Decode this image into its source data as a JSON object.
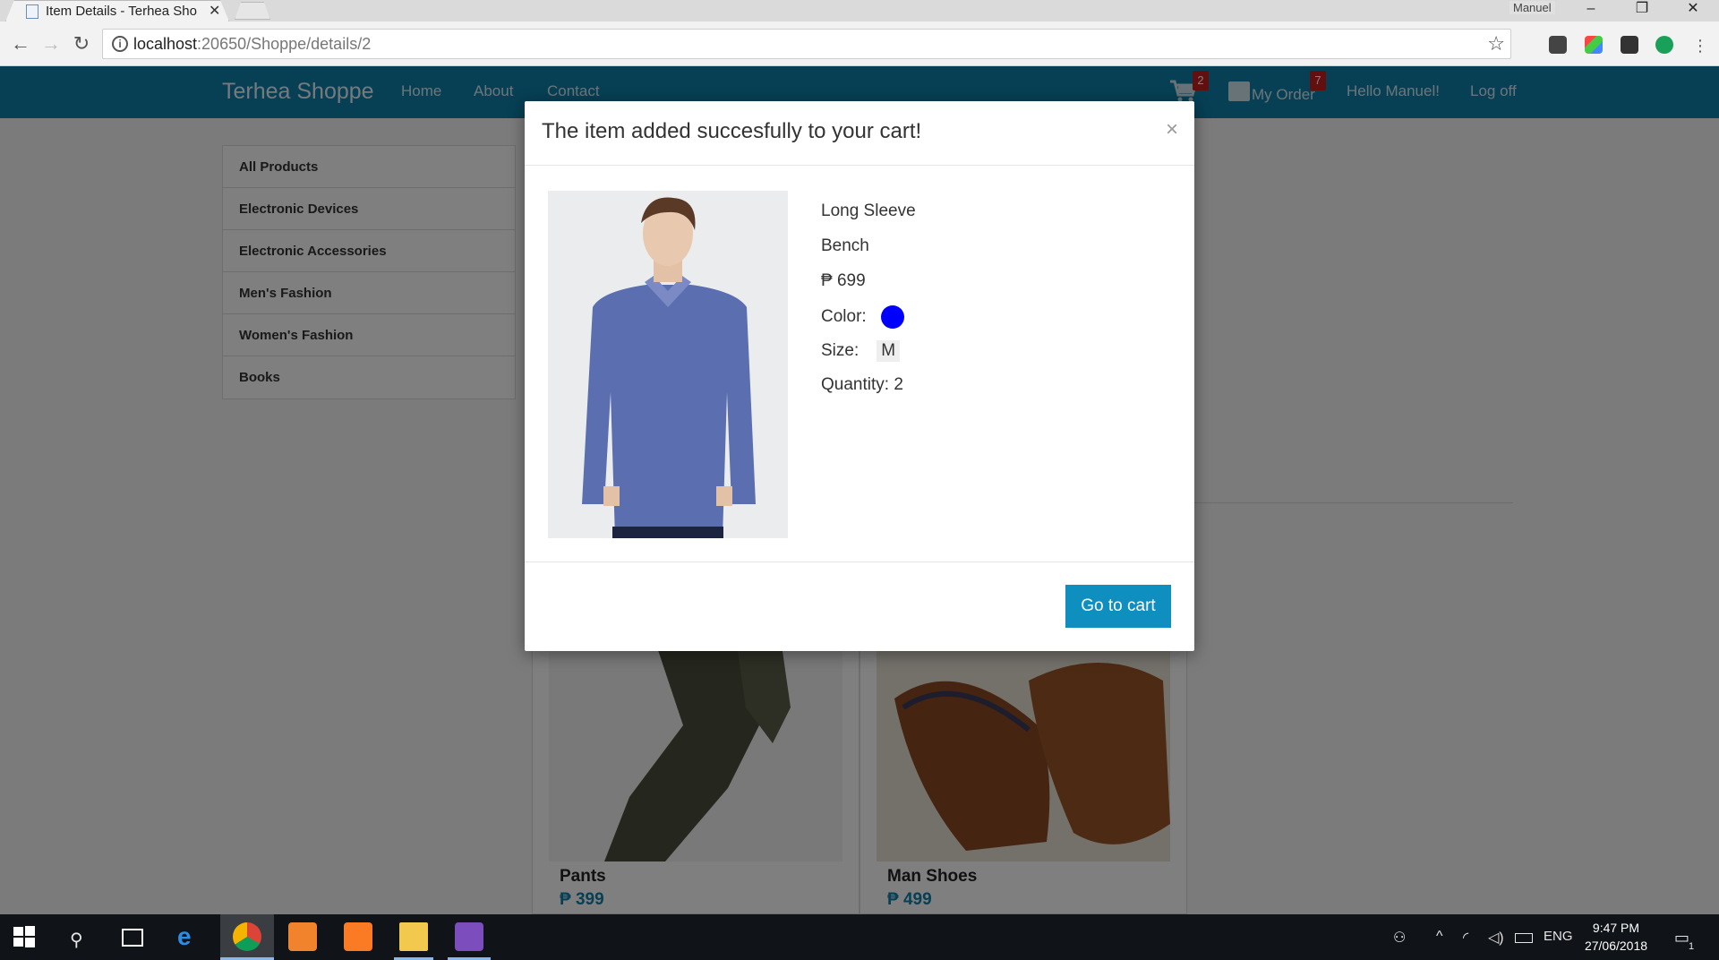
{
  "browser": {
    "tab_title": "Item Details - Terhea Sho",
    "user": "Manuel",
    "url_host": "localhost",
    "url_path": ":20650/Shoppe/details/2"
  },
  "navbar": {
    "brand": "Terhea Shoppe",
    "links": [
      "Home",
      "About",
      "Contact"
    ],
    "cart_count": "2",
    "order_label": "My Order",
    "order_count": "7",
    "greeting": "Hello Manuel!",
    "logoff": "Log off"
  },
  "sidebar": {
    "items": [
      "All Products",
      "Electronic Devices",
      "Electronic Accessories",
      "Men's Fashion",
      "Women's Fashion",
      "Books"
    ]
  },
  "products": [
    {
      "name": "Pants",
      "price": "₱ 399"
    },
    {
      "name": "Man Shoes",
      "price": "₱ 499"
    }
  ],
  "modal": {
    "title": "The item added succesfully to your cart!",
    "close": "×",
    "name": "Long Sleeve",
    "brand": "Bench",
    "price": "₱ 699",
    "color_label": "Color:",
    "color": "#0000ff",
    "size_label": "Size:",
    "size": "M",
    "quantity": "Quantity: 2",
    "button": "Go to cart"
  },
  "taskbar": {
    "lang": "ENG",
    "time": "9:47 PM",
    "date": "27/06/2018",
    "notifications": "1"
  }
}
